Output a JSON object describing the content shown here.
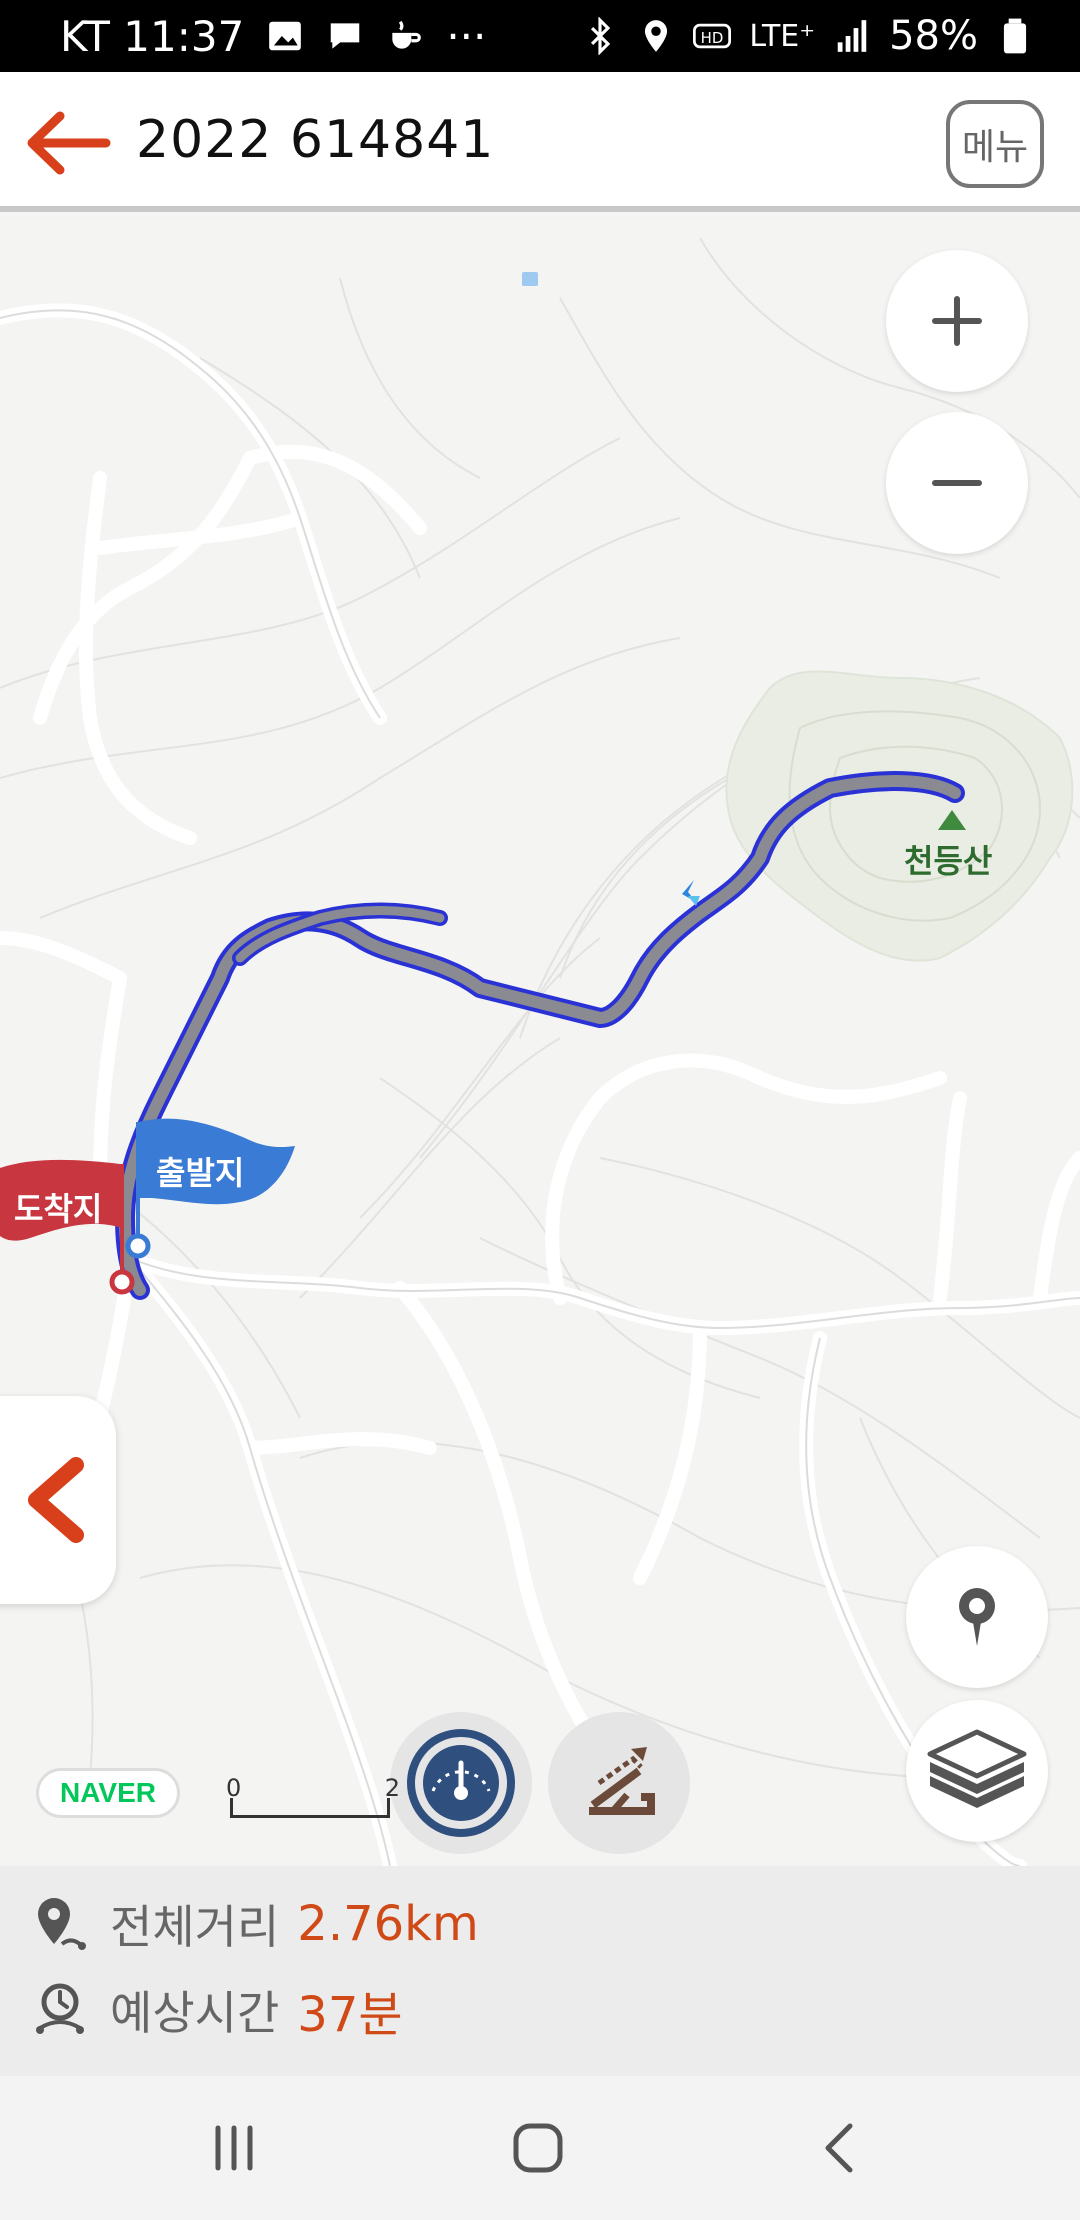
{
  "status": {
    "carrier_time": "KT 11:37",
    "more": "···",
    "network": "LTE⁺",
    "battery": "58%"
  },
  "header": {
    "title": "2022 614841",
    "menu_label": "메뉴"
  },
  "map": {
    "mountain_name": "천등산",
    "start_label": "출발지",
    "end_label": "도착지",
    "naver_logo": "NAVER",
    "scale_start": "0",
    "scale_end": "2",
    "route_color": "#2a32d6",
    "start_color": "#3a7bd5",
    "end_color": "#c8363f"
  },
  "info": {
    "distance_label": "전체거리",
    "distance_value": "2.76km",
    "time_label": "예상시간",
    "time_value": "37분"
  }
}
